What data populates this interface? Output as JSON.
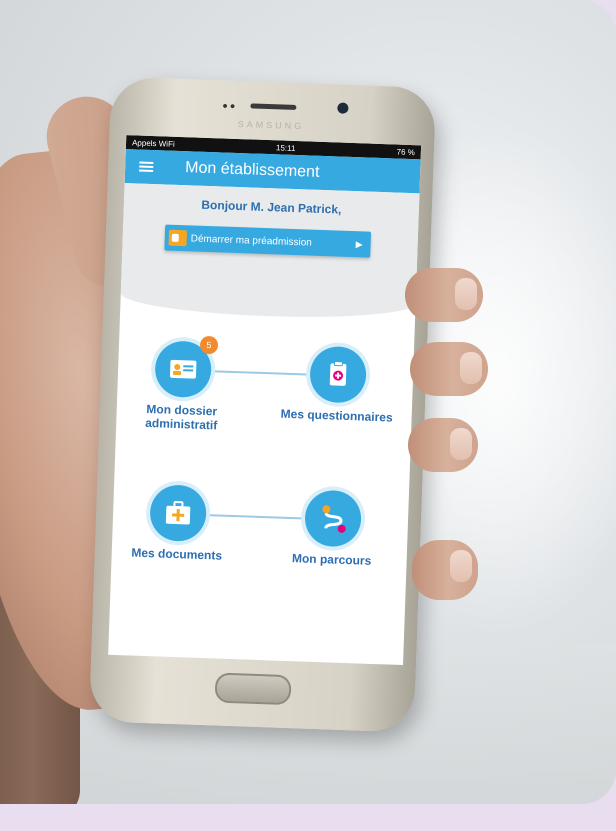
{
  "device": {
    "brand": "SAMSUNG"
  },
  "status_bar": {
    "carrier": "Appels WiFi",
    "time": "15:11",
    "battery": "76 %"
  },
  "app_bar": {
    "title": "Mon établissement",
    "menu_icon": "hamburger-menu-icon"
  },
  "hero": {
    "greeting": "Bonjour M. Jean Patrick,",
    "cta_label": "Démarrer ma préadmission",
    "cta_icon": "id-card-icon",
    "cta_arrow": "▶"
  },
  "tiles": [
    {
      "label_line1": "Mon dossier",
      "label_line2": "administratif",
      "icon": "id-card-icon",
      "badge": "5"
    },
    {
      "label_line1": "Mes questionnaires",
      "label_line2": "",
      "icon": "clipboard-icon",
      "badge": ""
    },
    {
      "label_line1": "Mes documents",
      "label_line2": "",
      "icon": "medical-kit-icon",
      "badge": ""
    },
    {
      "label_line1": "Mon parcours",
      "label_line2": "",
      "icon": "path-icon",
      "badge": ""
    }
  ],
  "colors": {
    "primary": "#36a9e1",
    "text_blue": "#2d6fb0",
    "badge_orange": "#f28a2e",
    "pink": "#e6007e",
    "background_lavender": "#e9ddf0"
  }
}
